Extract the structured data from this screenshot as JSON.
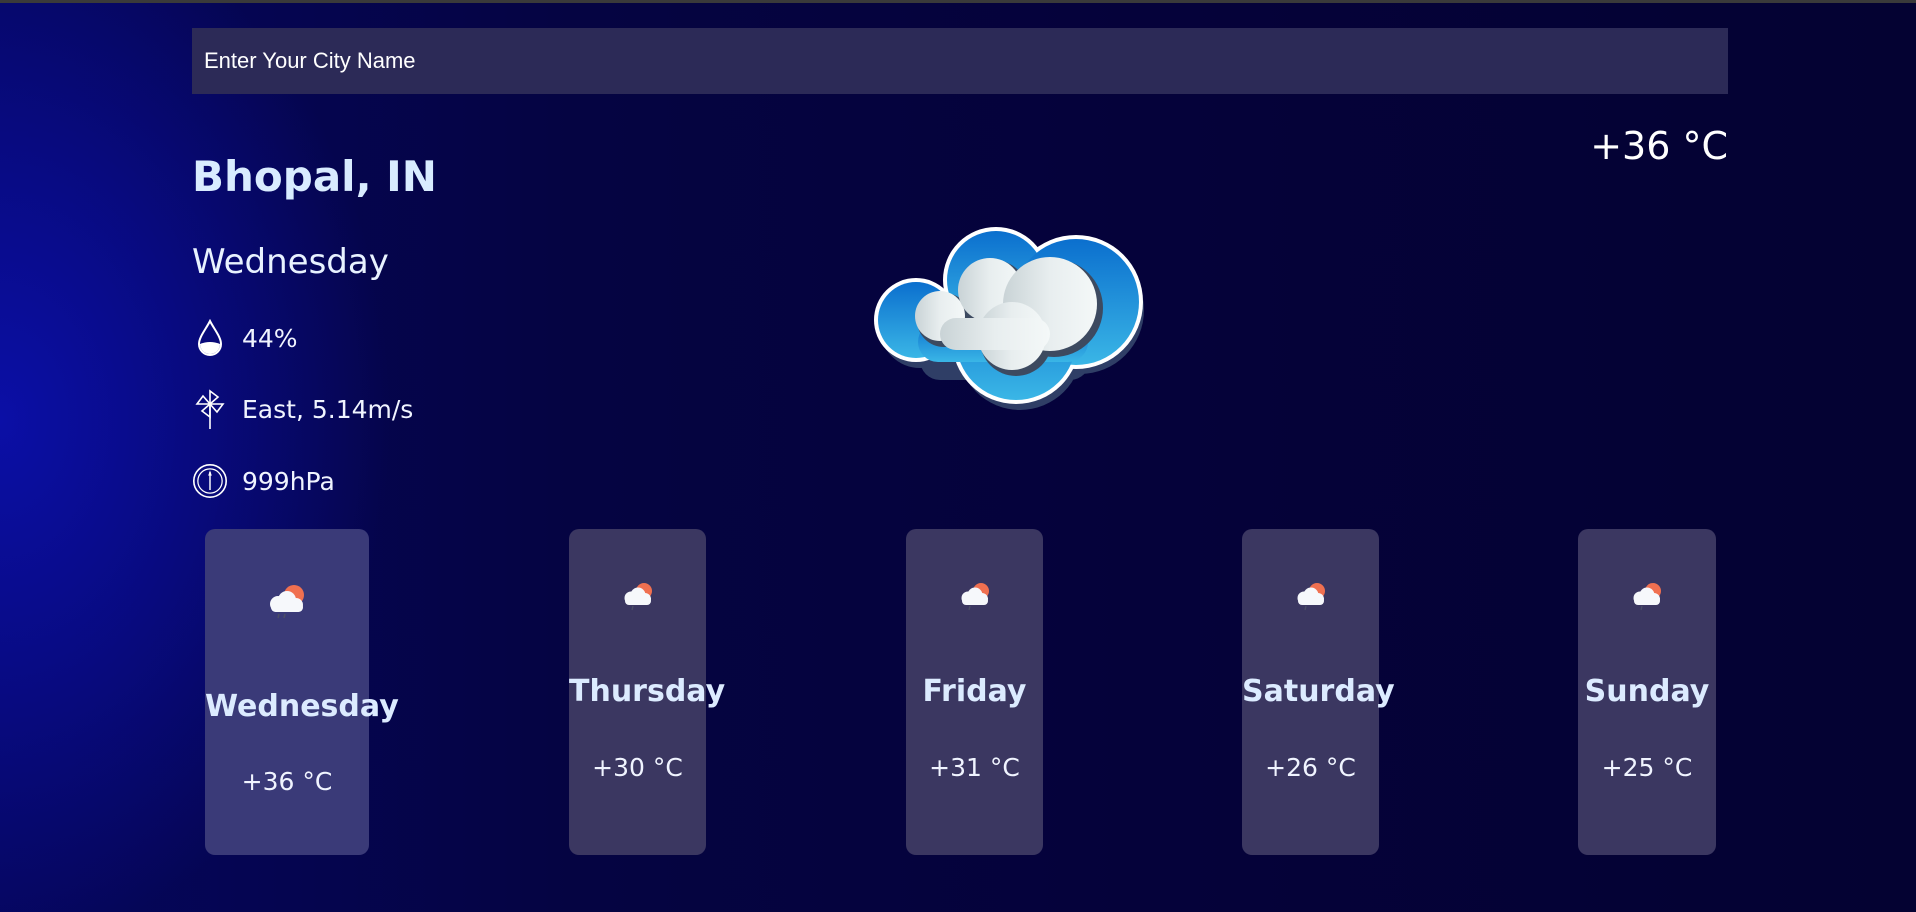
{
  "search": {
    "placeholder": "Enter Your City Name",
    "value": ""
  },
  "current": {
    "city": "Bhopal, IN",
    "day": "Wednesday",
    "humidity": "44%",
    "wind": "East, 5.14m/s",
    "pressure": "999hPa",
    "temperature": "+36 °C",
    "icon": "cloud-icon"
  },
  "forecast": [
    {
      "day": "Wednesday",
      "temp": "+36 °C",
      "icon": "cloud-sun-icon"
    },
    {
      "day": "Thursday",
      "temp": "+30 °C",
      "icon": "cloud-sun-icon"
    },
    {
      "day": "Friday",
      "temp": "+31 °C",
      "icon": "cloud-sun-icon"
    },
    {
      "day": "Saturday",
      "temp": "+26 °C",
      "icon": "cloud-sun-icon"
    },
    {
      "day": "Sunday",
      "temp": "+25 °C",
      "icon": "cloud-sun-icon"
    }
  ],
  "colors": {
    "background": "#05023a",
    "card": "#3b3761",
    "search_bg": "#2c2a57",
    "city_text": "#d9ecff"
  }
}
